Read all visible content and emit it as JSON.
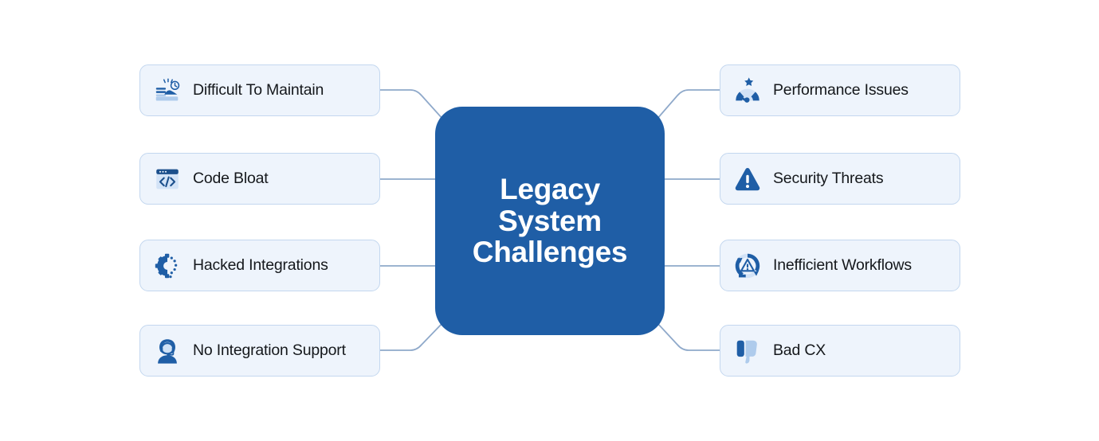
{
  "diagram": {
    "type": "mind-map",
    "background_color": "#ffffff",
    "hub": {
      "title": "Legacy\nSystem\nChallenges",
      "title_lines": [
        "Legacy",
        "System",
        "Challenges"
      ],
      "fill_color": "#1f5ea6",
      "text_color": "#ffffff"
    },
    "card_style": {
      "fill_color": "#eef4fc",
      "border_color": "#c3d7ef",
      "label_color": "#15181c",
      "icon_color": "#1f5ea6",
      "icon_accent_color": "#aecbec"
    },
    "connector_color": "#8fa9ca",
    "left_branches": [
      {
        "label": "Difficult To Maintain",
        "icon": "maintenance-clock-icon"
      },
      {
        "label": "Code Bloat",
        "icon": "code-window-icon"
      },
      {
        "label": "Hacked Integrations",
        "icon": "broken-gear-icon"
      },
      {
        "label": "No Integration Support",
        "icon": "support-agent-icon"
      }
    ],
    "right_branches": [
      {
        "label": "Performance Issues",
        "icon": "speedometer-star-icon"
      },
      {
        "label": "Security Threats",
        "icon": "warning-triangle-icon"
      },
      {
        "label": "Inefficient Workflows",
        "icon": "recycle-warning-icon"
      },
      {
        "label": "Bad CX",
        "icon": "thumbs-down-icon"
      }
    ]
  }
}
